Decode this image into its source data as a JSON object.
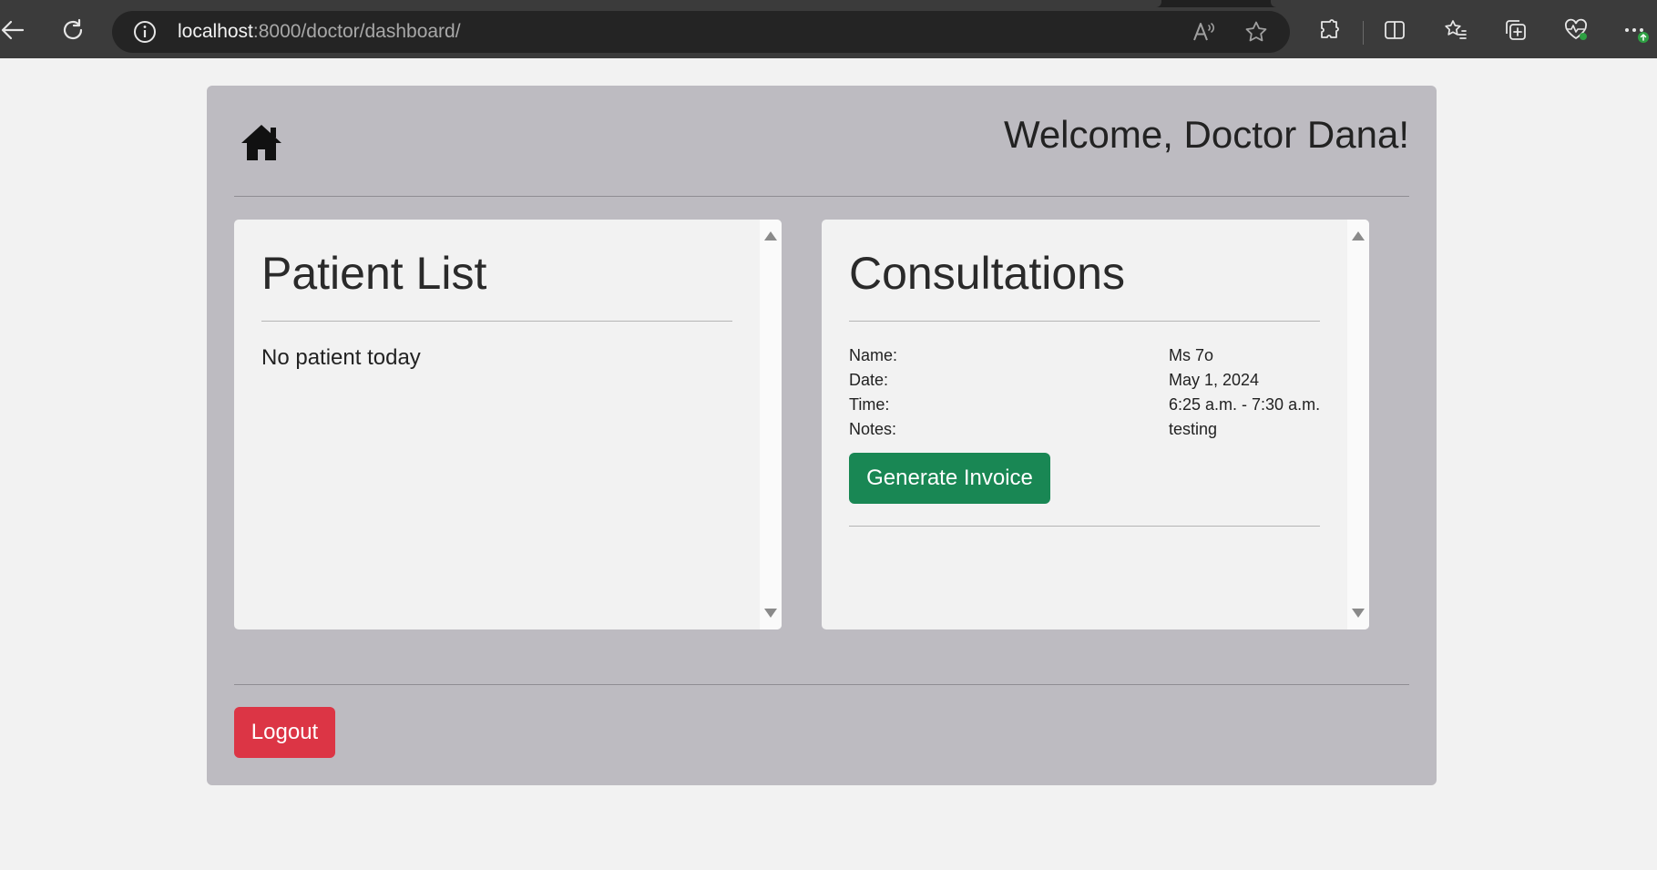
{
  "browser": {
    "url_host": "localhost",
    "url_path": ":8000/doctor/dashboard/"
  },
  "header": {
    "welcome": "Welcome, Doctor Dana!"
  },
  "patient_list": {
    "title": "Patient List",
    "empty_message": "No patient today"
  },
  "consultations": {
    "title": "Consultations",
    "entry": {
      "name_label": "Name:",
      "name_value": "Ms 7o",
      "date_label": "Date:",
      "date_value": "May 1, 2024",
      "time_label": "Time:",
      "time_value": "6:25 a.m. - 7:30 a.m.",
      "notes_label": "Notes:",
      "notes_value": "testing"
    },
    "invoice_button": "Generate Invoice"
  },
  "footer": {
    "logout_button": "Logout"
  },
  "colors": {
    "panel_bg": "#bdbbc1",
    "invoice_button": "#198754",
    "logout_button": "#dc3545"
  },
  "icons": {
    "home": "home-icon",
    "back": "back-arrow-icon",
    "refresh": "refresh-icon",
    "info": "info-icon",
    "read_aloud": "read-aloud-icon",
    "favorite": "star-icon",
    "extensions": "puzzle-icon",
    "split_screen": "split-screen-icon",
    "favorites": "favorites-icon",
    "collections": "collections-icon",
    "browser_essentials": "heartbeat-icon",
    "menu": "more-icon"
  }
}
